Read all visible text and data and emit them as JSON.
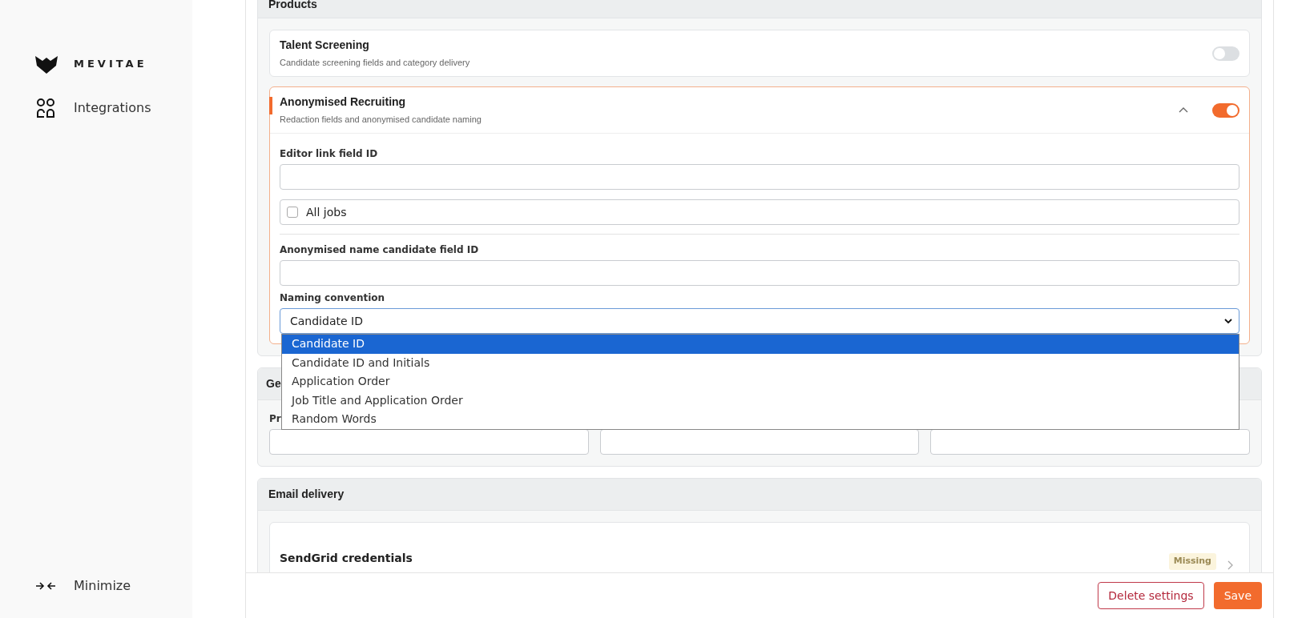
{
  "sidebar": {
    "logo_text": "MEVITAE",
    "items": [
      {
        "label": "Integrations"
      }
    ],
    "footer_item": {
      "label": "Minimize"
    }
  },
  "products": {
    "title": "Products",
    "items": [
      {
        "title": "Talent Screening",
        "subtitle": "Candidate screening fields and category delivery",
        "on": false,
        "expanded": false
      },
      {
        "title": "Anonymised Recruiting",
        "subtitle": "Redaction fields and anonymised candidate naming",
        "on": true,
        "expanded": true,
        "fields": [
          {
            "kind": "text",
            "label": "Editor link field ID"
          },
          {
            "kind": "checkbox",
            "label": "All jobs",
            "checked": false
          },
          {
            "kind": "text",
            "label": "Anonymised name candidate field ID"
          },
          {
            "kind": "select",
            "label": "Naming convention",
            "value": "Candidate ID",
            "expanded": true,
            "options": [
              {
                "label": "Candidate ID",
                "selected": true
              },
              {
                "label": "Candidate ID and Initials",
                "selected": false
              },
              {
                "label": "Application Order",
                "selected": false
              },
              {
                "label": "Job Title and Application Order",
                "selected": false
              },
              {
                "label": "Random Words",
                "selected": false
              }
            ]
          }
        ]
      }
    ]
  },
  "general": {
    "title": "Ge",
    "fields": [
      {
        "kind": "text",
        "label": "Pr"
      },
      {
        "kind": "text"
      },
      {
        "kind": "text"
      }
    ]
  },
  "email_delivery": {
    "title": "Email delivery",
    "items": [
      {
        "title": "SendGrid credentials",
        "status": "Missing"
      }
    ]
  },
  "footer_buttons": [
    {
      "label": "Delete settings",
      "kind": "outline"
    },
    {
      "label": "Save",
      "kind": "primary"
    }
  ]
}
